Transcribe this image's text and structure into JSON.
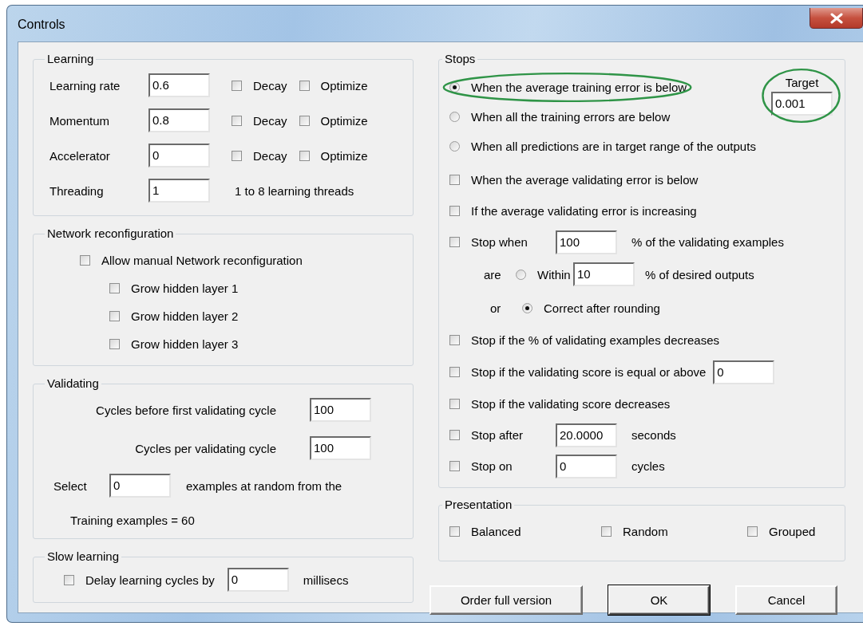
{
  "window": {
    "title": "Controls"
  },
  "learning": {
    "title": "Learning",
    "rows": [
      {
        "label": "Learning rate",
        "value": "0.6",
        "options": [
          {
            "label": "Decay",
            "checked": false
          },
          {
            "label": "Optimize",
            "checked": false
          }
        ]
      },
      {
        "label": "Momentum",
        "value": "0.8",
        "options": [
          {
            "label": "Decay",
            "checked": false
          },
          {
            "label": "Optimize",
            "checked": false
          }
        ]
      },
      {
        "label": "Accelerator",
        "value": "0",
        "options": [
          {
            "label": "Decay",
            "checked": false
          },
          {
            "label": "Optimize",
            "checked": false
          }
        ]
      },
      {
        "label": "Threading",
        "value": "1",
        "note": "1 to 8 learning threads"
      }
    ]
  },
  "network": {
    "title": "Network reconfiguration",
    "allow": {
      "label": "Allow manual Network reconfiguration",
      "checked": false
    },
    "layers": [
      {
        "label": "Grow hidden layer 1",
        "checked": false
      },
      {
        "label": "Grow hidden layer 2",
        "checked": false
      },
      {
        "label": "Grow hidden layer 3",
        "checked": false
      }
    ]
  },
  "validating": {
    "title": "Validating",
    "fields": [
      {
        "label": "Cycles before first validating cycle",
        "value": "100"
      },
      {
        "label": "Cycles per validating cycle",
        "value": "100"
      }
    ],
    "select": {
      "label": "Select",
      "value": "0",
      "suffix": "examples at random from the"
    },
    "training_examples": "Training examples = 60"
  },
  "slow_learning": {
    "title": "Slow learning",
    "label": "Delay learning cycles by",
    "checked": false,
    "value": "0",
    "unit": "millisecs"
  },
  "stops": {
    "title": "Stops",
    "target": {
      "label": "Target",
      "value": "0.001",
      "circled": true
    },
    "items": [
      {
        "kind": "radio",
        "label": "When the average training error is below",
        "selected": true,
        "circled": true
      },
      {
        "kind": "radio",
        "label": "When all the training errors are below",
        "selected": false,
        "circled": false
      },
      {
        "kind": "radio",
        "label": "When all predictions are in target range of the outputs",
        "selected": false,
        "circled": false
      },
      {
        "kind": "checkbox",
        "label": "When the average validating error is below",
        "checked": false
      },
      {
        "kind": "checkbox",
        "label": "If the average validating error is increasing",
        "checked": false
      },
      {
        "kind": "checkbox-field",
        "label": "Stop when",
        "checked": false,
        "value": "100",
        "suffix": "% of the validating examples"
      },
      {
        "kind": "choice",
        "prefix": "are",
        "label": "Within",
        "selected": false,
        "value": "10",
        "suffix": "% of desired outputs"
      },
      {
        "kind": "choice",
        "prefix": "or",
        "label": "Correct after rounding",
        "selected": true
      },
      {
        "kind": "checkbox",
        "label": "Stop if the % of validating examples decreases",
        "checked": false
      },
      {
        "kind": "checkbox-trailing-field",
        "label": "Stop if the validating score is equal or above",
        "checked": false,
        "value": "0"
      },
      {
        "kind": "checkbox",
        "label": "Stop if the validating score decreases",
        "checked": false
      },
      {
        "kind": "checkbox-field",
        "label": "Stop after",
        "checked": false,
        "value": "20.0000",
        "suffix": "seconds"
      },
      {
        "kind": "checkbox-field",
        "label": "Stop on",
        "checked": false,
        "value": "0",
        "suffix": "cycles"
      }
    ]
  },
  "presentation": {
    "title": "Presentation",
    "options": [
      {
        "label": "Balanced",
        "checked": false
      },
      {
        "label": "Random",
        "checked": false
      },
      {
        "label": "Grouped",
        "checked": false
      }
    ]
  },
  "buttons": [
    {
      "label": "Order full version",
      "default": false
    },
    {
      "label": "OK",
      "default": true
    },
    {
      "label": "Cancel",
      "default": false
    }
  ]
}
